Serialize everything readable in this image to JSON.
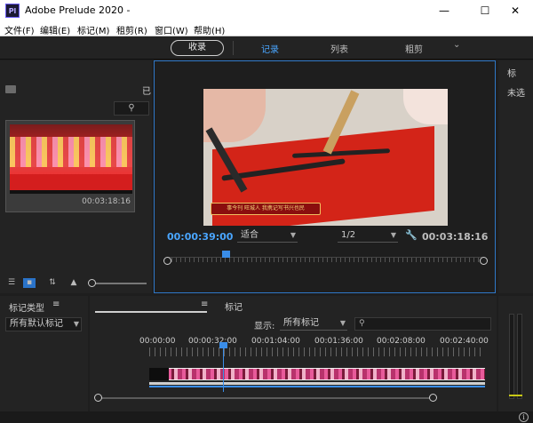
{
  "app": {
    "icon_text": "Pl",
    "title": "Adobe Prelude 2020 -",
    "window_controls": {
      "minimize": "—",
      "maximize": "☐",
      "close": "✕"
    }
  },
  "menu": {
    "items": [
      "文件(F)",
      "编辑(E)",
      "标记(M)",
      "租剪(R)",
      "窗口(W)",
      "帮助(H)"
    ]
  },
  "workspace": {
    "ingest": "收录",
    "tabs": [
      "记录",
      "列表",
      "粗剪"
    ],
    "active_tab": "记录",
    "more": "⌄",
    "accent": "#4aa6ff"
  },
  "project": {
    "clip_label": "已",
    "search_icon": "search-icon",
    "clip_duration": "00:03:18:16"
  },
  "monitor": {
    "caption": "事今刊 旺城人 我携记写书兴也民",
    "current_tc": "00:00:39:00",
    "fit": "适合",
    "resolution": "1/2",
    "duration_tc": "00:03:18:16",
    "border_color": "#2f78c8"
  },
  "right_panel": {
    "label1": "标",
    "label2": "未选"
  },
  "markers": {
    "type_title": "标记类型",
    "menu": "≡",
    "default_select": "所有默认标记"
  },
  "timeline": {
    "menu": "≡",
    "tab2": "标记",
    "show_label": "显示:",
    "show_select": "所有标记",
    "search_placeholder": "",
    "ruler": [
      "00:00:00",
      "00:00:32:00",
      "00:01:04:00",
      "00:01:36:00",
      "00:02:08:00",
      "00:02:40:00"
    ]
  },
  "status": {
    "info": "i"
  }
}
